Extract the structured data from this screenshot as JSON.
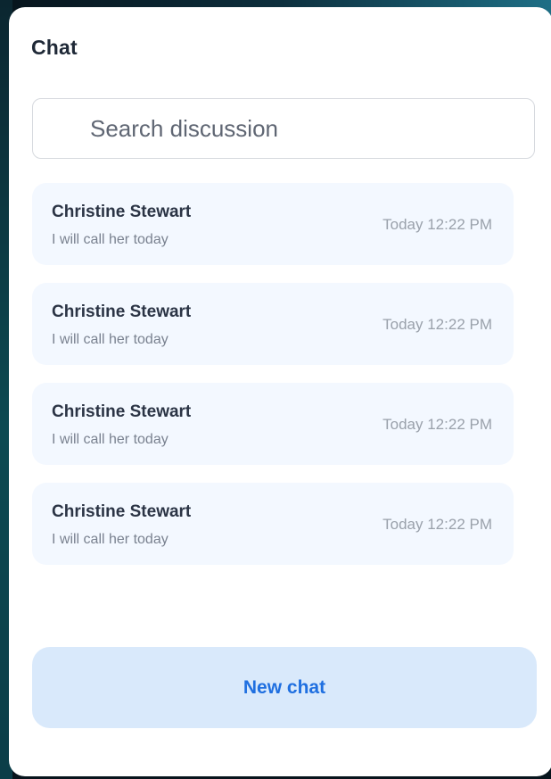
{
  "header": {
    "title": "Chat"
  },
  "search": {
    "placeholder": "Search discussion",
    "value": ""
  },
  "chats": [
    {
      "name": "Christine Stewart",
      "preview": "I will call her today",
      "time": "Today 12:22 PM"
    },
    {
      "name": "Christine Stewart",
      "preview": "I will call her today",
      "time": "Today 12:22 PM"
    },
    {
      "name": "Christine Stewart",
      "preview": "I will call her today",
      "time": "Today 12:22 PM"
    },
    {
      "name": "Christine Stewart",
      "preview": "I will call her today",
      "time": "Today 12:22 PM"
    }
  ],
  "actions": {
    "new_chat_label": "New chat"
  },
  "colors": {
    "accent": "#1f6fe0",
    "button_bg": "#d9e9fb",
    "item_bg": "#f3f8ff"
  }
}
